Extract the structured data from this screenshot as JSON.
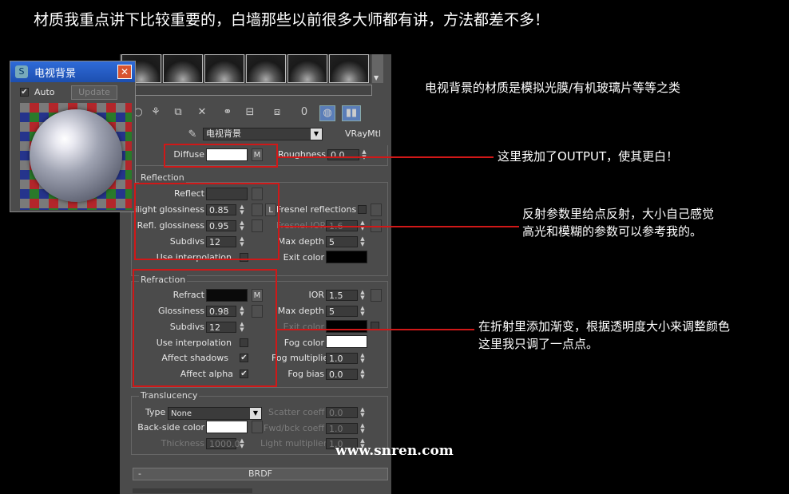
{
  "heading": "材质我重点讲下比较重要的，白墙那些以前很多大师都有讲，方法都差不多！",
  "notes": {
    "tv_material": "电视背景的材质是模拟光膜/有机玻璃片等等之类",
    "output": "这里我加了OUTPUT，使其更白！",
    "reflect_line1": "反射参数里给点反射，大小自己感觉",
    "reflect_line2": "高光和模糊的参数可以参考我的。",
    "refract_line1": "在折射里添加渐变，根据透明度大小来调整颜色",
    "refract_line2": "这里我只调了一点点。"
  },
  "watermark": "www.snren.com",
  "preview": {
    "title": "电视背景",
    "auto_label": "Auto",
    "auto_checked": true,
    "update_label": "Update"
  },
  "material": {
    "name": "电视背景",
    "type": "VRayMtl"
  },
  "toolbar": {
    "zero_label": "0"
  },
  "basic": {
    "diffuse_label": "Diffuse",
    "m": "M",
    "roughness_label": "Roughness",
    "roughness_value": "0.0"
  },
  "reflection": {
    "title": "Reflection",
    "reflect_label": "Reflect",
    "hilight_label": "Hilight glossiness",
    "hilight_value": "0.85",
    "l_label": "L",
    "refl_gloss_label": "Refl. glossiness",
    "refl_gloss_value": "0.95",
    "subdivs_label": "Subdivs",
    "subdivs_value": "12",
    "use_interp_label": "Use interpolation",
    "fresnel_label": "Fresnel reflections",
    "fresnel_ior_label": "Fresnel IOR",
    "fresnel_ior_value": "1.6",
    "max_depth_label": "Max depth",
    "max_depth_value": "5",
    "exit_color_label": "Exit color"
  },
  "refraction": {
    "title": "Refraction",
    "refract_label": "Refract",
    "m": "M",
    "gloss_label": "Glossiness",
    "gloss_value": "0.98",
    "subdivs_label": "Subdivs",
    "subdivs_value": "12",
    "use_interp_label": "Use interpolation",
    "affect_shadows_label": "Affect shadows",
    "affect_alpha_label": "Affect alpha",
    "ior_label": "IOR",
    "ior_value": "1.5",
    "max_depth_label": "Max depth",
    "max_depth_value": "5",
    "exit_color_label": "Exit color",
    "fog_color_label": "Fog color",
    "fog_mult_label": "Fog multiplier",
    "fog_mult_value": "1.0",
    "fog_bias_label": "Fog bias",
    "fog_bias_value": "0.0"
  },
  "translucency": {
    "title": "Translucency",
    "type_label": "Type",
    "type_value": "None",
    "backside_label": "Back-side color",
    "thickness_label": "Thickness",
    "thickness_value": "1000.0",
    "scatter_label": "Scatter coeff",
    "scatter_value": "0.0",
    "fwd_label": "Fwd/bck coeff",
    "fwd_value": "1.0",
    "light_mult_label": "Light multiplier",
    "light_mult_value": "1.0"
  },
  "brdf": {
    "collapse": "-",
    "title": "BRDF"
  },
  "colors": {
    "annotation_red": "#d01818",
    "panel_gray": "#4b4b4b",
    "title_blue": "#2f6bd8"
  }
}
